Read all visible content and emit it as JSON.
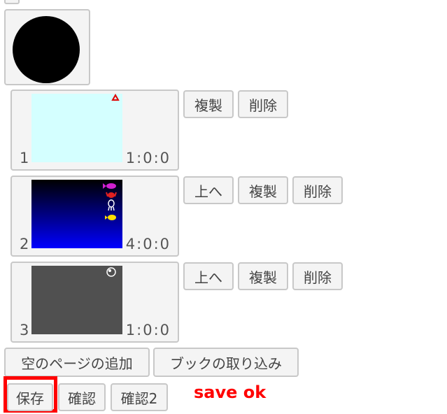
{
  "pages": [
    {
      "number": "1",
      "time": "1:0:0",
      "background": "#d4ffff",
      "icons": [
        "triangle-icon"
      ],
      "buttons": {
        "copy": "複製",
        "delete": "削除"
      }
    },
    {
      "number": "2",
      "time": "4:0:0",
      "background": "gradient-black-to-blue",
      "icons": [
        "fish-icon",
        "crab-icon",
        "squid-icon",
        "yellow-fish-icon"
      ],
      "buttons": {
        "up": "上へ",
        "copy": "複製",
        "delete": "削除"
      }
    },
    {
      "number": "3",
      "time": "1:0:0",
      "background": "#505050",
      "icons": [
        "bubble-icon"
      ],
      "buttons": {
        "up": "上へ",
        "copy": "複製",
        "delete": "削除"
      }
    }
  ],
  "actions": {
    "add_empty_page": "空のページの追加",
    "import_book": "ブックの取り込み"
  },
  "footer": {
    "save": "保存",
    "confirm": "確認",
    "confirm2": "確認2",
    "status": "save ok"
  },
  "colors": {
    "highlight": "#ff0000",
    "status": "#ff0000",
    "button_bg": "#f4f4f4",
    "button_border": "#c8c8c8"
  }
}
